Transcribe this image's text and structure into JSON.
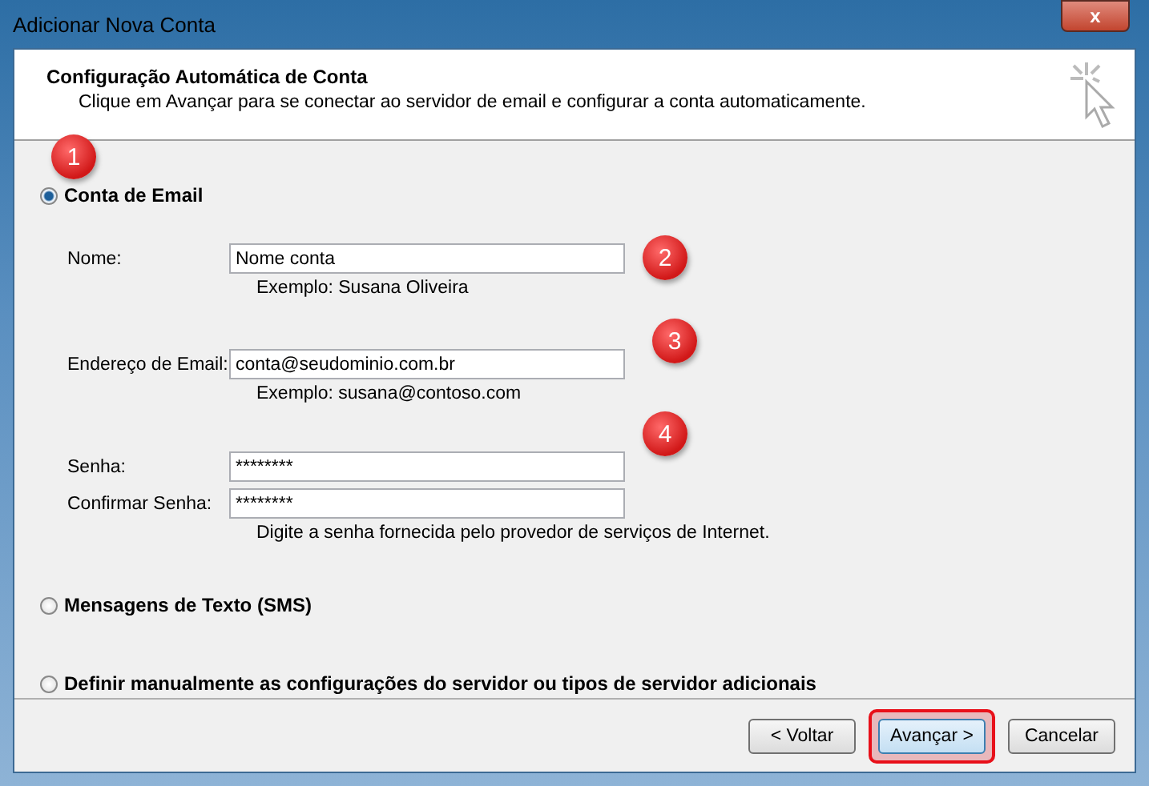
{
  "window": {
    "title": "Adicionar Nova Conta",
    "close_label": "x"
  },
  "header": {
    "title": "Configuração Automática de Conta",
    "subtitle": "Clique em Avançar para se conectar ao servidor de email e configurar a conta automaticamente."
  },
  "options": [
    {
      "label": "Conta de Email",
      "selected": true
    },
    {
      "label": "Mensagens de Texto (SMS)",
      "selected": false
    },
    {
      "label": "Definir manualmente as configurações do servidor ou tipos de servidor adicionais",
      "selected": false
    }
  ],
  "fields": [
    {
      "label": "Nome:",
      "value": "Nome conta",
      "hint": "Exemplo: Susana Oliveira"
    },
    {
      "label": "Endereço de Email:",
      "value": "conta@seudominio.com.br",
      "hint": "Exemplo: susana@contoso.com"
    },
    {
      "label": "Senha:",
      "value": "********"
    },
    {
      "label": "Confirmar Senha:",
      "value": "********",
      "hint": "Digite a senha fornecida pelo provedor de serviços de Internet."
    }
  ],
  "markers": [
    "1",
    "2",
    "3",
    "4"
  ],
  "buttons": [
    {
      "label": "< Voltar",
      "highlighted": false
    },
    {
      "label": "Avançar >",
      "highlighted": true
    },
    {
      "label": "Cancelar",
      "highlighted": false
    }
  ]
}
